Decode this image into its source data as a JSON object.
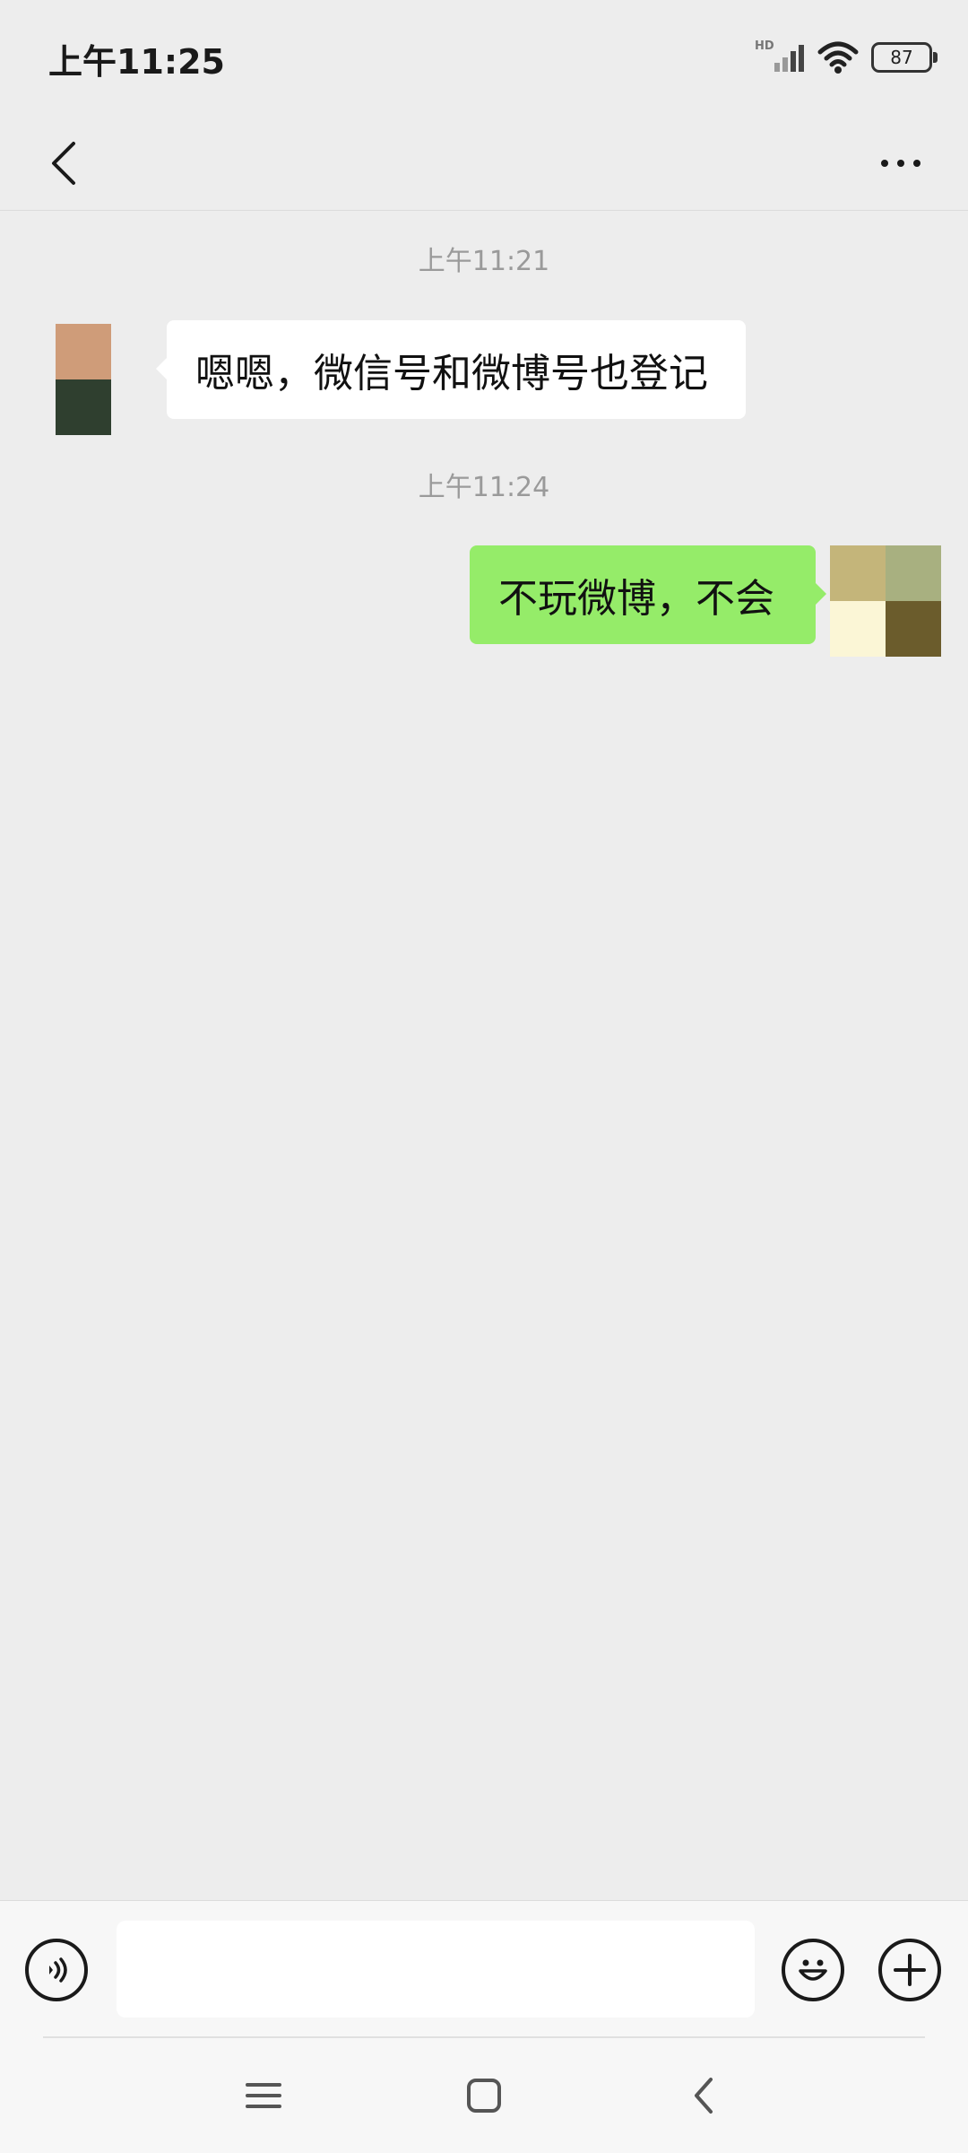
{
  "status_bar": {
    "time": "上午11:25",
    "signal_label": "HD",
    "battery": "87",
    "icons": [
      "signal-icon",
      "wifi-icon",
      "battery-icon"
    ]
  },
  "title_bar": {
    "back_icon": "back-chevron-icon",
    "more_icon": "more-dots-icon"
  },
  "messages": [
    {
      "type": "timestamp",
      "text": "上午11:21"
    },
    {
      "type": "incoming",
      "text": "嗯嗯，微信号和微博号也登记"
    },
    {
      "type": "timestamp",
      "text": "上午11:24"
    },
    {
      "type": "outgoing",
      "text": "不玩微博，不会"
    }
  ],
  "input_bar": {
    "voice_icon": "voice-icon",
    "text_value": "",
    "emoji_icon": "emoji-icon",
    "plus_icon": "plus-icon"
  },
  "colors": {
    "background": "#ededed",
    "outgoing_bubble": "#95ec69",
    "incoming_bubble": "#ffffff",
    "timestamp_text": "#9a9a9a"
  },
  "nav_bar": {
    "icons": [
      "menu-icon",
      "home-icon",
      "back-icon"
    ]
  }
}
